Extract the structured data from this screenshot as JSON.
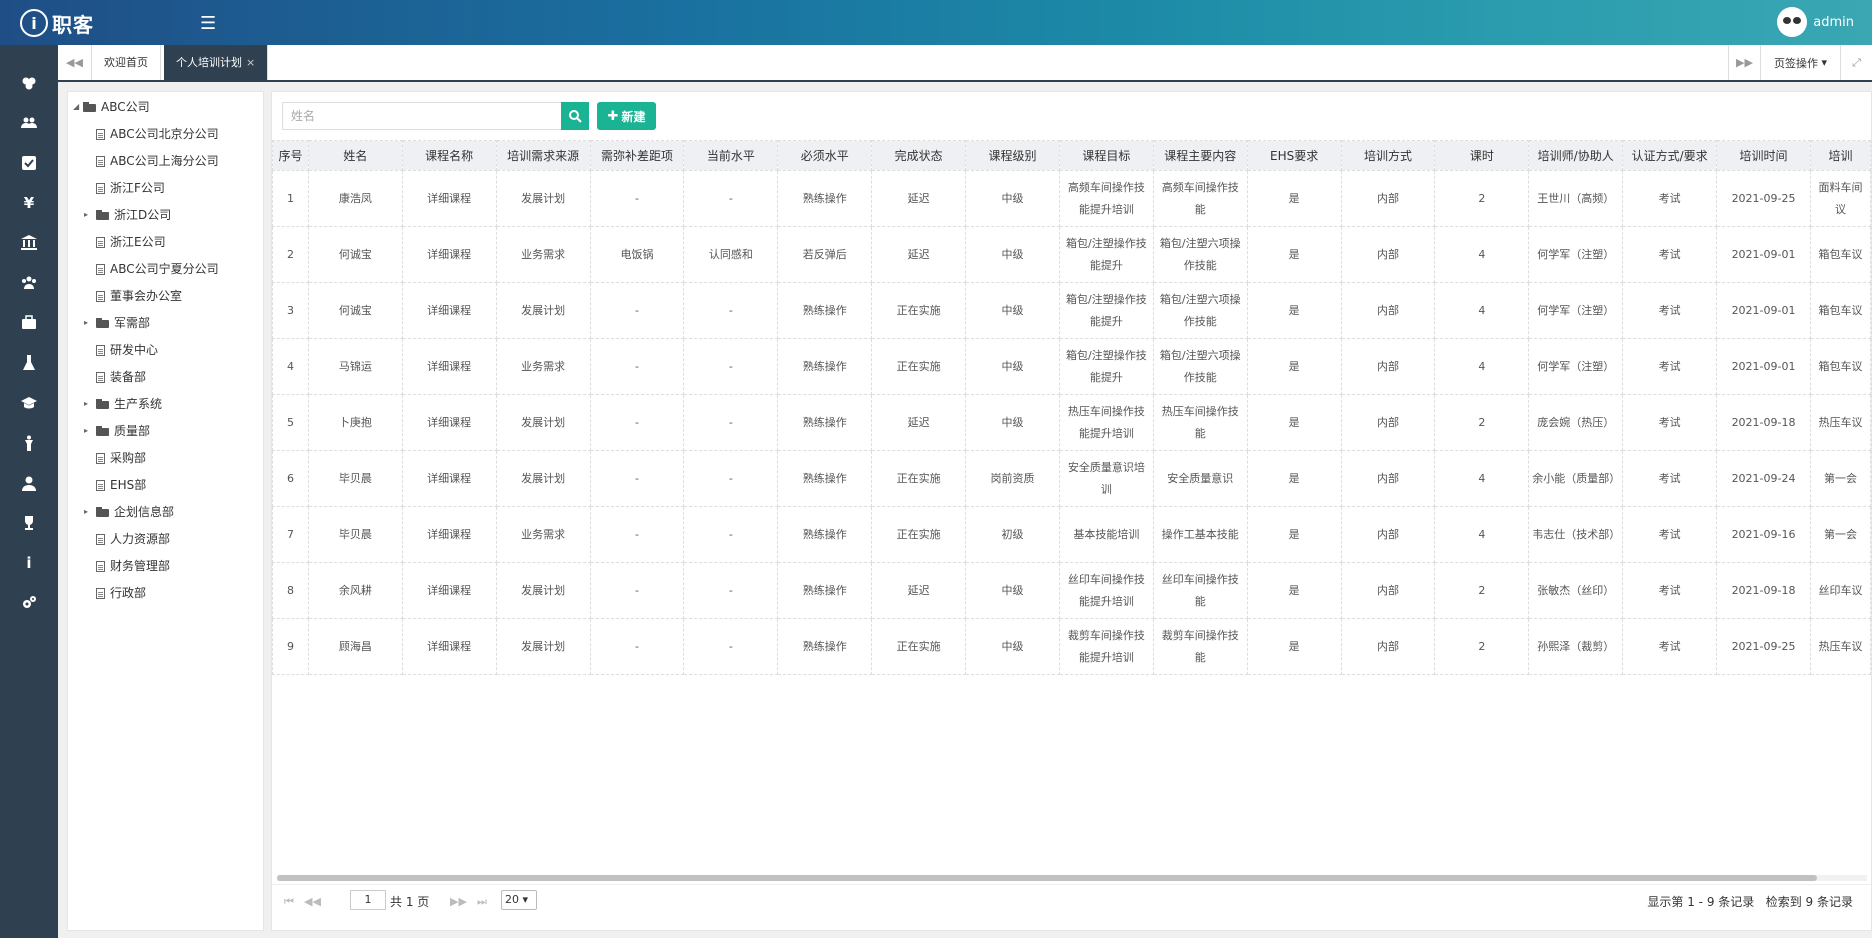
{
  "header": {
    "logo_mark": "i",
    "logo_text": "职客",
    "user_name": "admin"
  },
  "sidebar_icons": [
    "dashboard-icon",
    "users-icon",
    "check-icon",
    "yen-icon",
    "bank-icon",
    "group-icon",
    "briefcase-icon",
    "flask-icon",
    "graduation-icon",
    "figure-icon",
    "user-icon",
    "trophy-icon",
    "info-icon",
    "cogs-icon"
  ],
  "tabs": {
    "home": "欢迎首页",
    "active": "个人培训计划",
    "close": "×",
    "page_ops": "页签操作"
  },
  "tree": {
    "root": "ABC公司",
    "items": [
      {
        "label": "ABC公司北京分公司",
        "type": "file"
      },
      {
        "label": "ABC公司上海分公司",
        "type": "file"
      },
      {
        "label": "浙江F公司",
        "type": "file"
      },
      {
        "label": "浙江D公司",
        "type": "folder"
      },
      {
        "label": "浙江E公司",
        "type": "file"
      },
      {
        "label": "ABC公司宁夏分公司",
        "type": "file"
      },
      {
        "label": "董事会办公室",
        "type": "file"
      },
      {
        "label": "军需部",
        "type": "folder"
      },
      {
        "label": "研发中心",
        "type": "file"
      },
      {
        "label": "装备部",
        "type": "file"
      },
      {
        "label": "生产系统",
        "type": "folder"
      },
      {
        "label": "质量部",
        "type": "folder"
      },
      {
        "label": "采购部",
        "type": "file"
      },
      {
        "label": "EHS部",
        "type": "file"
      },
      {
        "label": "企划信息部",
        "type": "folder"
      },
      {
        "label": "人力资源部",
        "type": "file"
      },
      {
        "label": "财务管理部",
        "type": "file"
      },
      {
        "label": "行政部",
        "type": "file"
      }
    ]
  },
  "toolbar": {
    "search_placeholder": "姓名",
    "new_label": "新建"
  },
  "table": {
    "columns": [
      "序号",
      "姓名",
      "课程名称",
      "培训需求来源",
      "需弥补差距项",
      "当前水平",
      "必须水平",
      "完成状态",
      "课程级别",
      "课程目标",
      "课程主要内容",
      "EHS要求",
      "培训方式",
      "课时",
      "培训师/协助人",
      "认证方式/要求",
      "培训时间",
      "培训"
    ],
    "rows": [
      [
        "1",
        "康浩凤",
        "详细课程",
        "发展计划",
        "-",
        "-",
        "熟练操作",
        "延迟",
        "中级",
        "高频车间操作技能提升培训",
        "高频车间操作技能",
        "是",
        "内部",
        "2",
        "王世川（高频）",
        "考试",
        "2021-09-25",
        "面料车间议"
      ],
      [
        "2",
        "何诚宝",
        "详细课程",
        "业务需求",
        "电饭锅",
        "认同感和",
        "若反弹后",
        "延迟",
        "中级",
        "箱包/注塑操作技能提升",
        "箱包/注塑六项操作技能",
        "是",
        "内部",
        "4",
        "何学军（注塑）",
        "考试",
        "2021-09-01",
        "箱包车议"
      ],
      [
        "3",
        "何诚宝",
        "详细课程",
        "发展计划",
        "-",
        "-",
        "熟练操作",
        "正在实施",
        "中级",
        "箱包/注塑操作技能提升",
        "箱包/注塑六项操作技能",
        "是",
        "内部",
        "4",
        "何学军（注塑）",
        "考试",
        "2021-09-01",
        "箱包车议"
      ],
      [
        "4",
        "马锦运",
        "详细课程",
        "业务需求",
        "-",
        "-",
        "熟练操作",
        "正在实施",
        "中级",
        "箱包/注塑操作技能提升",
        "箱包/注塑六项操作技能",
        "是",
        "内部",
        "4",
        "何学军（注塑）",
        "考试",
        "2021-09-01",
        "箱包车议"
      ],
      [
        "5",
        "卜庚抱",
        "详细课程",
        "发展计划",
        "-",
        "-",
        "熟练操作",
        "延迟",
        "中级",
        "热压车间操作技能提升培训",
        "热压车间操作技能",
        "是",
        "内部",
        "2",
        "庞会婉（热压）",
        "考试",
        "2021-09-18",
        "热压车议"
      ],
      [
        "6",
        "毕贝晨",
        "详细课程",
        "发展计划",
        "-",
        "-",
        "熟练操作",
        "正在实施",
        "岗前资质",
        "安全质量意识培训",
        "安全质量意识",
        "是",
        "内部",
        "4",
        "余小能（质量部）",
        "考试",
        "2021-09-24",
        "第一会"
      ],
      [
        "7",
        "毕贝晨",
        "详细课程",
        "业务需求",
        "-",
        "-",
        "熟练操作",
        "正在实施",
        "初级",
        "基本技能培训",
        "操作工基本技能",
        "是",
        "内部",
        "4",
        "韦志仕（技术部）",
        "考试",
        "2021-09-16",
        "第一会"
      ],
      [
        "8",
        "余风耕",
        "详细课程",
        "发展计划",
        "-",
        "-",
        "熟练操作",
        "延迟",
        "中级",
        "丝印车间操作技能提升培训",
        "丝印车间操作技能",
        "是",
        "内部",
        "2",
        "张敏杰（丝印）",
        "考试",
        "2021-09-18",
        "丝印车议"
      ],
      [
        "9",
        "顾海昌",
        "详细课程",
        "发展计划",
        "-",
        "-",
        "熟练操作",
        "正在实施",
        "中级",
        "裁剪车间操作技能提升培训",
        "裁剪车间操作技能",
        "是",
        "内部",
        "2",
        "孙熙泽（裁剪）",
        "考试",
        "2021-09-25",
        "热压车议"
      ]
    ]
  },
  "pager": {
    "page": "1",
    "total_pages": "共 1 页",
    "page_size": "20",
    "info_range": "显示第 1 - 9 条记录",
    "info_total": "检索到 9 条记录"
  },
  "colors": {
    "sidebar": "#2f4050",
    "accent": "#1ab394"
  }
}
